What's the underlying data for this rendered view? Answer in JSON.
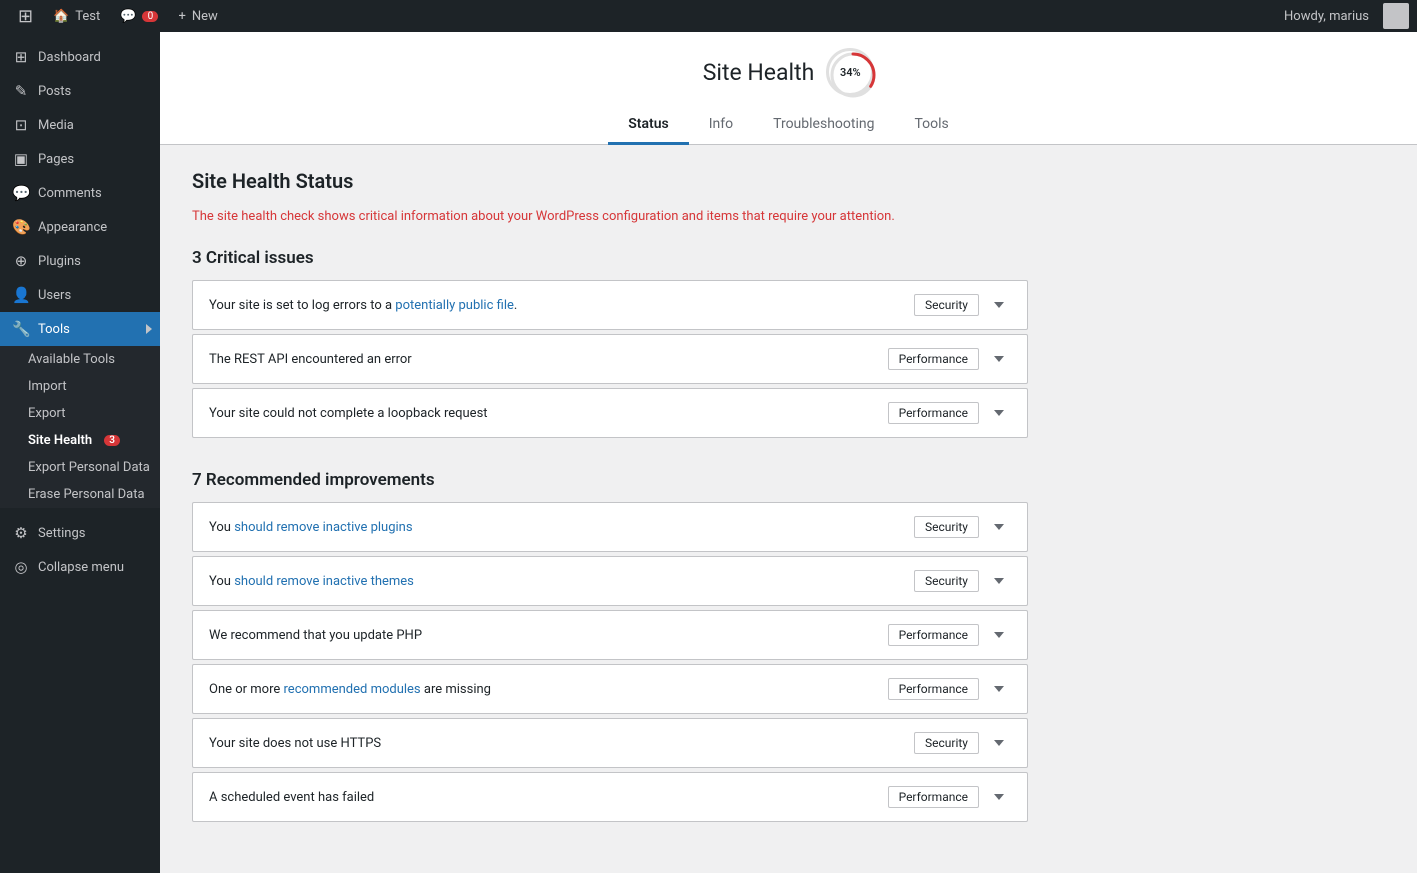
{
  "adminBar": {
    "wpLogoLabel": "WordPress",
    "siteLabel": "Test",
    "commentsLabel": "",
    "commentsCount": "0",
    "newLabel": "New",
    "howdy": "Howdy, marius"
  },
  "sidebar": {
    "items": [
      {
        "id": "dashboard",
        "label": "Dashboard",
        "icon": "⊞"
      },
      {
        "id": "posts",
        "label": "Posts",
        "icon": "✎"
      },
      {
        "id": "media",
        "label": "Media",
        "icon": "⊡"
      },
      {
        "id": "pages",
        "label": "Pages",
        "icon": "▣"
      },
      {
        "id": "comments",
        "label": "Comments",
        "icon": "💬"
      },
      {
        "id": "appearance",
        "label": "Appearance",
        "icon": "🎨"
      },
      {
        "id": "plugins",
        "label": "Plugins",
        "icon": "⊕"
      },
      {
        "id": "users",
        "label": "Users",
        "icon": "👤"
      },
      {
        "id": "tools",
        "label": "Tools",
        "icon": "🔧",
        "active": true
      }
    ],
    "toolsSubmenu": [
      {
        "id": "available-tools",
        "label": "Available Tools"
      },
      {
        "id": "import",
        "label": "Import"
      },
      {
        "id": "export",
        "label": "Export"
      },
      {
        "id": "site-health",
        "label": "Site Health",
        "badge": "3",
        "activeSub": true
      },
      {
        "id": "export-personal-data",
        "label": "Export Personal Data"
      },
      {
        "id": "erase-personal-data",
        "label": "Erase Personal Data"
      }
    ],
    "settingsLabel": "Settings",
    "settingsIcon": "⚙",
    "collapseLabel": "Collapse menu"
  },
  "page": {
    "title": "Site Health",
    "healthPercent": "34%",
    "tabs": [
      {
        "id": "status",
        "label": "Status",
        "active": true
      },
      {
        "id": "info",
        "label": "Info"
      },
      {
        "id": "troubleshooting",
        "label": "Troubleshooting"
      },
      {
        "id": "tools",
        "label": "Tools"
      }
    ],
    "sectionTitle": "Site Health Status",
    "sectionDesc": "The site health check shows critical information about your WordPress configuration and items that require your attention.",
    "criticalTitle": "3 Critical issues",
    "criticalIssues": [
      {
        "text": "Your site is set to log errors to a potentially public file.",
        "tag": "Security"
      },
      {
        "text": "The REST API encountered an error",
        "tag": "Performance"
      },
      {
        "text": "Your site could not complete a loopback request",
        "tag": "Performance"
      }
    ],
    "recommendedTitle": "7 Recommended improvements",
    "recommendedIssues": [
      {
        "text": "You should remove inactive plugins",
        "tag": "Security"
      },
      {
        "text": "You should remove inactive themes",
        "tag": "Security"
      },
      {
        "text": "We recommend that you update PHP",
        "tag": "Performance"
      },
      {
        "text": "One or more recommended modules are missing",
        "tag": "Performance"
      },
      {
        "text": "Your site does not use HTTPS",
        "tag": "Security"
      },
      {
        "text": "A scheduled event has failed",
        "tag": "Performance"
      }
    ]
  }
}
